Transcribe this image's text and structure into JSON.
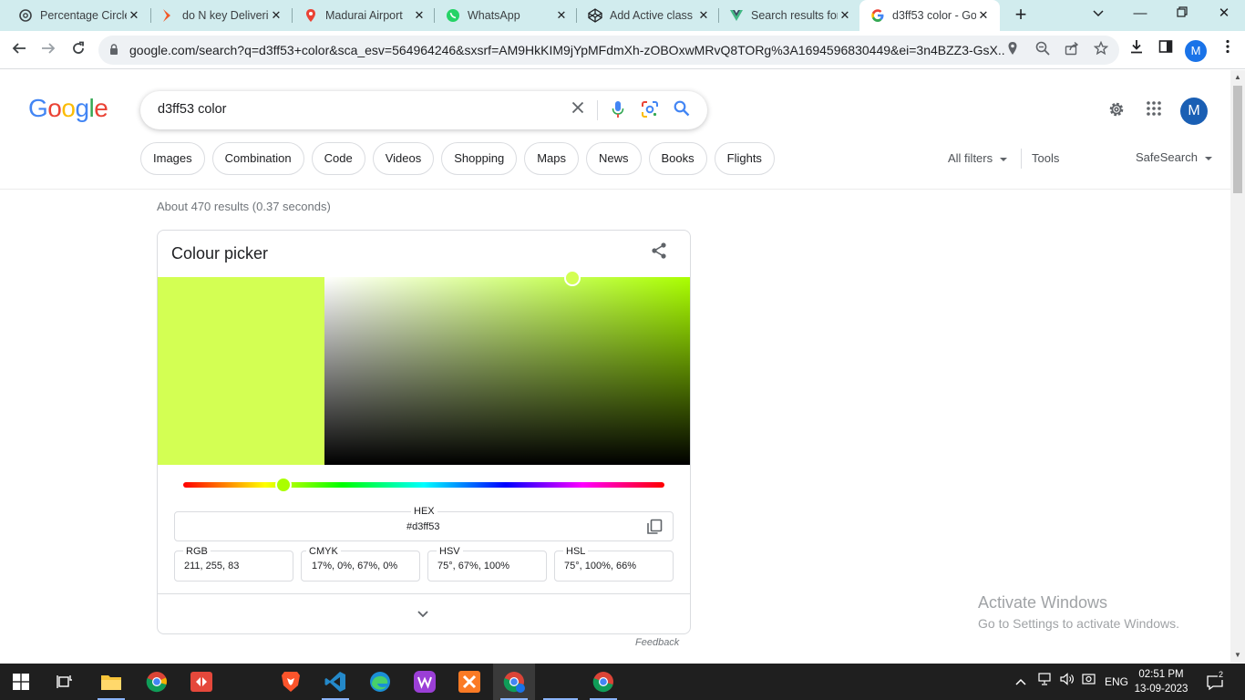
{
  "browser": {
    "tabs": [
      {
        "title": "Percentage Circle",
        "icon": "chatgpt-icon"
      },
      {
        "title": "do N key Deliveri",
        "icon": "app-icon"
      },
      {
        "title": "Madurai Airport",
        "icon": "google-maps-icon"
      },
      {
        "title": "WhatsApp",
        "icon": "whatsapp-icon"
      },
      {
        "title": "Add Active class",
        "icon": "codepen-icon"
      },
      {
        "title": "Search results for",
        "icon": "vue-icon"
      },
      {
        "title": "d3ff53 color - Go",
        "icon": "google-icon",
        "active": true
      }
    ],
    "new_tab_label": "+",
    "url": "google.com/search?q=d3ff53+color&sca_esv=564964246&sxsrf=AM9HkKIM9jYpMFdmXh-zOBOxwMRvQ8TORg%3A1694596830449&ei=3n4BZZ3-GsX...",
    "profile_initial": "M"
  },
  "google": {
    "logo": "Google",
    "query": "d3ff53 color",
    "avatar_initial": "M",
    "chips": [
      "Images",
      "Combination",
      "Code",
      "Videos",
      "Shopping",
      "Maps",
      "News",
      "Books",
      "Flights"
    ],
    "all_filters": "All filters",
    "tools": "Tools",
    "safesearch": "SafeSearch",
    "stats": "About 470 results (0.37 seconds)"
  },
  "picker": {
    "title": "Colour picker",
    "color": "#d3ff53",
    "hue_color": "#aaff00",
    "hue_position": 0.208,
    "hex_label": "HEX",
    "hex_value": "#d3ff53",
    "fields": [
      {
        "label": "RGB",
        "value": "211, 255, 83"
      },
      {
        "label": "CMYK",
        "value": "17%, 0%, 67%, 0%"
      },
      {
        "label": "HSV",
        "value": "75°, 67%, 100%"
      },
      {
        "label": "HSL",
        "value": "75°, 100%, 66%"
      }
    ],
    "feedback": "Feedback"
  },
  "watermark": {
    "line1": "Activate Windows",
    "line2": "Go to Settings to activate Windows."
  },
  "taskbar": {
    "language": "ENG",
    "time": "02:51 PM",
    "date": "13-09-2023",
    "notification_count": "2"
  }
}
